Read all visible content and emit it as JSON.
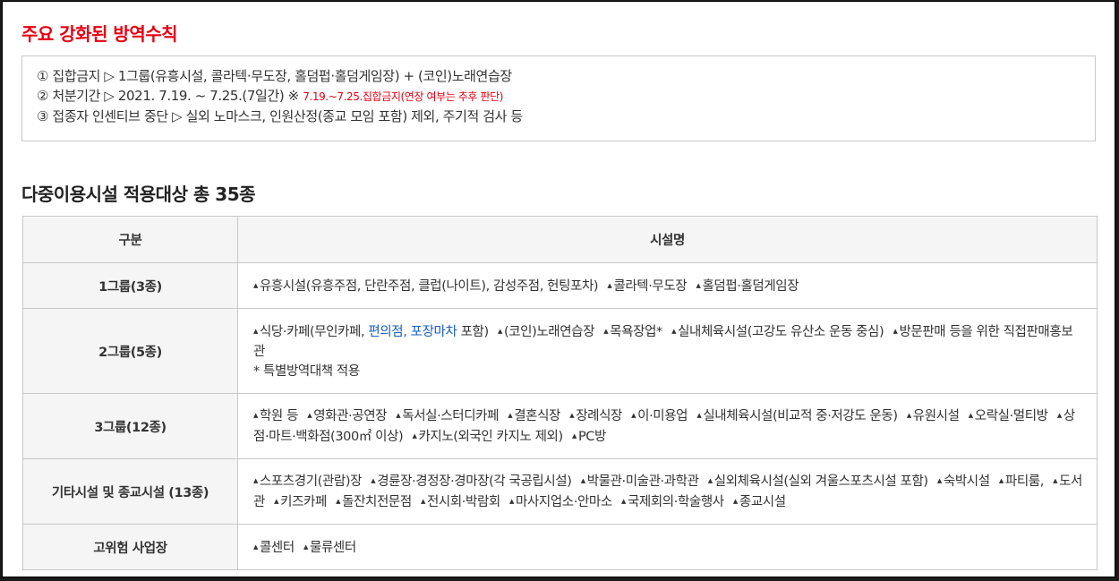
{
  "section1": {
    "title": "주요 강화된 방역수칙",
    "lines": [
      "① 집합금지 ▷ 1그룹(유흥시설, 콜라텍·무도장, 홀덤펍·홀덤게임장) + (코인)노래연습장",
      "② 처분기간 ▷ 2021. 7.19. ~ 7.25.(7일간) ※ ",
      "③ 접종자 인센티브 중단 ▷ 실외 노마스크, 인원산정(종교 모임 포함) 제외, 주기적 검사 등"
    ],
    "line2_note": "7.19.~7.25.집합금지(연장 여부는 추후 판단)"
  },
  "section2": {
    "title": "다중이용시설 적용대상 총 35종",
    "header": {
      "col1": "구분",
      "col2": "시설명"
    },
    "bullet": "▲",
    "rows": [
      {
        "label": "1그룹(3종)",
        "items": [
          "유흥시설(유흥주점, 단란주점, 클럽(나이트), 감성주점, 헌팅포차)",
          "콜라텍·무도장",
          "홀덤펍·홀덤게임장"
        ]
      },
      {
        "label": "2그룹(5종)",
        "item1_a": "식당·카페(무인카페, ",
        "item1_blue": "편의점, 포장마차",
        "item1_b": " 포함)",
        "items": [
          "(코인)노래연습장",
          "목욕장업*",
          "실내체육시설(고강도 유산소 운동 중심)",
          "방문판매 등을 위한 직접판매홍보관"
        ],
        "note": "* 특별방역대책 적용"
      },
      {
        "label": "3그룹(12종)",
        "items": [
          "학원 등",
          "영화관·공연장",
          "독서실·스터디카페",
          "결혼식장",
          "장례식장",
          "이·미용업",
          "실내체육시설(비교적 중·저강도 운동)",
          "유원시설",
          "오락실·멀티방",
          "상점·마트·백화점(300㎡ 이상)",
          "카지노(외국인 카지노 제외)",
          "PC방"
        ]
      },
      {
        "label": "기타시설 및 종교시설 (13종)",
        "items": [
          "스포츠경기(관람)장",
          "경륜장·경정장·경마장(각 국공립시설)",
          "박물관·미술관·과학관",
          "실외체육시설(실외 겨울스포츠시설 포함)",
          "숙박시설",
          "파티룸,",
          "도서관",
          "키즈카페",
          "돌잔치전문점",
          "전시회·박람회",
          "마사지업소·안마소",
          "국제회의·학술행사",
          "종교시설"
        ]
      },
      {
        "label": "고위험 사업장",
        "items": [
          "콜센터",
          "물류센터"
        ]
      }
    ]
  }
}
